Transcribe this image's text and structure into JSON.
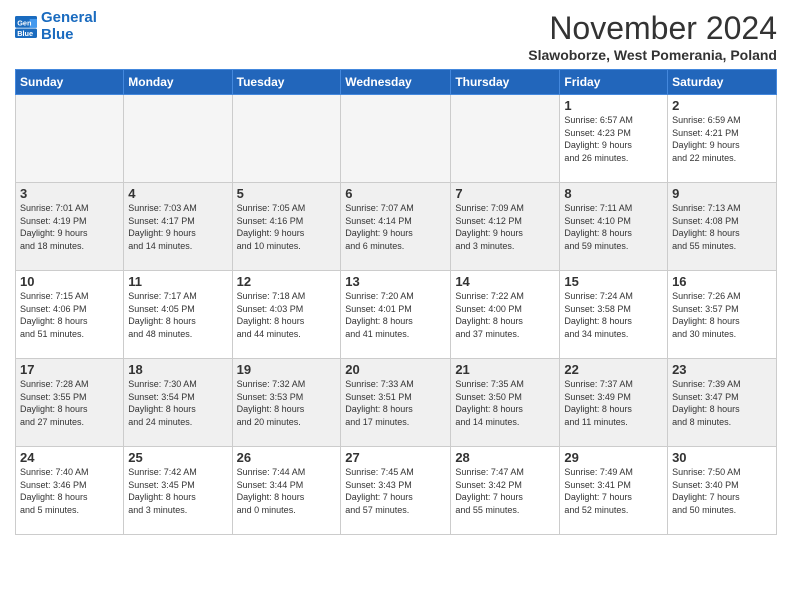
{
  "header": {
    "logo_line1": "General",
    "logo_line2": "Blue",
    "month": "November 2024",
    "location": "Slawoborze, West Pomerania, Poland"
  },
  "days_of_week": [
    "Sunday",
    "Monday",
    "Tuesday",
    "Wednesday",
    "Thursday",
    "Friday",
    "Saturday"
  ],
  "weeks": [
    {
      "shaded": false,
      "days": [
        {
          "num": "",
          "info": ""
        },
        {
          "num": "",
          "info": ""
        },
        {
          "num": "",
          "info": ""
        },
        {
          "num": "",
          "info": ""
        },
        {
          "num": "",
          "info": ""
        },
        {
          "num": "1",
          "info": "Sunrise: 6:57 AM\nSunset: 4:23 PM\nDaylight: 9 hours\nand 26 minutes."
        },
        {
          "num": "2",
          "info": "Sunrise: 6:59 AM\nSunset: 4:21 PM\nDaylight: 9 hours\nand 22 minutes."
        }
      ]
    },
    {
      "shaded": true,
      "days": [
        {
          "num": "3",
          "info": "Sunrise: 7:01 AM\nSunset: 4:19 PM\nDaylight: 9 hours\nand 18 minutes."
        },
        {
          "num": "4",
          "info": "Sunrise: 7:03 AM\nSunset: 4:17 PM\nDaylight: 9 hours\nand 14 minutes."
        },
        {
          "num": "5",
          "info": "Sunrise: 7:05 AM\nSunset: 4:16 PM\nDaylight: 9 hours\nand 10 minutes."
        },
        {
          "num": "6",
          "info": "Sunrise: 7:07 AM\nSunset: 4:14 PM\nDaylight: 9 hours\nand 6 minutes."
        },
        {
          "num": "7",
          "info": "Sunrise: 7:09 AM\nSunset: 4:12 PM\nDaylight: 9 hours\nand 3 minutes."
        },
        {
          "num": "8",
          "info": "Sunrise: 7:11 AM\nSunset: 4:10 PM\nDaylight: 8 hours\nand 59 minutes."
        },
        {
          "num": "9",
          "info": "Sunrise: 7:13 AM\nSunset: 4:08 PM\nDaylight: 8 hours\nand 55 minutes."
        }
      ]
    },
    {
      "shaded": false,
      "days": [
        {
          "num": "10",
          "info": "Sunrise: 7:15 AM\nSunset: 4:06 PM\nDaylight: 8 hours\nand 51 minutes."
        },
        {
          "num": "11",
          "info": "Sunrise: 7:17 AM\nSunset: 4:05 PM\nDaylight: 8 hours\nand 48 minutes."
        },
        {
          "num": "12",
          "info": "Sunrise: 7:18 AM\nSunset: 4:03 PM\nDaylight: 8 hours\nand 44 minutes."
        },
        {
          "num": "13",
          "info": "Sunrise: 7:20 AM\nSunset: 4:01 PM\nDaylight: 8 hours\nand 41 minutes."
        },
        {
          "num": "14",
          "info": "Sunrise: 7:22 AM\nSunset: 4:00 PM\nDaylight: 8 hours\nand 37 minutes."
        },
        {
          "num": "15",
          "info": "Sunrise: 7:24 AM\nSunset: 3:58 PM\nDaylight: 8 hours\nand 34 minutes."
        },
        {
          "num": "16",
          "info": "Sunrise: 7:26 AM\nSunset: 3:57 PM\nDaylight: 8 hours\nand 30 minutes."
        }
      ]
    },
    {
      "shaded": true,
      "days": [
        {
          "num": "17",
          "info": "Sunrise: 7:28 AM\nSunset: 3:55 PM\nDaylight: 8 hours\nand 27 minutes."
        },
        {
          "num": "18",
          "info": "Sunrise: 7:30 AM\nSunset: 3:54 PM\nDaylight: 8 hours\nand 24 minutes."
        },
        {
          "num": "19",
          "info": "Sunrise: 7:32 AM\nSunset: 3:53 PM\nDaylight: 8 hours\nand 20 minutes."
        },
        {
          "num": "20",
          "info": "Sunrise: 7:33 AM\nSunset: 3:51 PM\nDaylight: 8 hours\nand 17 minutes."
        },
        {
          "num": "21",
          "info": "Sunrise: 7:35 AM\nSunset: 3:50 PM\nDaylight: 8 hours\nand 14 minutes."
        },
        {
          "num": "22",
          "info": "Sunrise: 7:37 AM\nSunset: 3:49 PM\nDaylight: 8 hours\nand 11 minutes."
        },
        {
          "num": "23",
          "info": "Sunrise: 7:39 AM\nSunset: 3:47 PM\nDaylight: 8 hours\nand 8 minutes."
        }
      ]
    },
    {
      "shaded": false,
      "days": [
        {
          "num": "24",
          "info": "Sunrise: 7:40 AM\nSunset: 3:46 PM\nDaylight: 8 hours\nand 5 minutes."
        },
        {
          "num": "25",
          "info": "Sunrise: 7:42 AM\nSunset: 3:45 PM\nDaylight: 8 hours\nand 3 minutes."
        },
        {
          "num": "26",
          "info": "Sunrise: 7:44 AM\nSunset: 3:44 PM\nDaylight: 8 hours\nand 0 minutes."
        },
        {
          "num": "27",
          "info": "Sunrise: 7:45 AM\nSunset: 3:43 PM\nDaylight: 7 hours\nand 57 minutes."
        },
        {
          "num": "28",
          "info": "Sunrise: 7:47 AM\nSunset: 3:42 PM\nDaylight: 7 hours\nand 55 minutes."
        },
        {
          "num": "29",
          "info": "Sunrise: 7:49 AM\nSunset: 3:41 PM\nDaylight: 7 hours\nand 52 minutes."
        },
        {
          "num": "30",
          "info": "Sunrise: 7:50 AM\nSunset: 3:40 PM\nDaylight: 7 hours\nand 50 minutes."
        }
      ]
    }
  ]
}
